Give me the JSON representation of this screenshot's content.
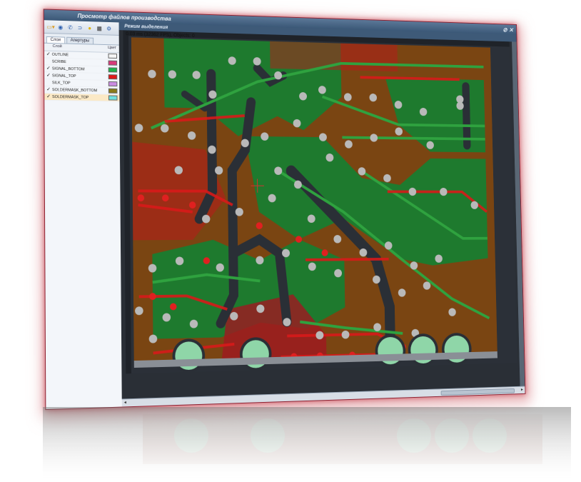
{
  "window": {
    "title": "Просмотр файлов производства",
    "controls": "⊘ ✕"
  },
  "toolbar": {
    "icons": [
      "folder-open-icon",
      "layers-icon",
      "phone-icon",
      "link-icon",
      "sun-icon",
      "grid-icon",
      "settings-icon"
    ]
  },
  "tabs": [
    {
      "label": "Слои",
      "active": true
    },
    {
      "label": "Апертуры",
      "active": false
    }
  ],
  "layers_panel": {
    "col_layer": "Слой",
    "col_color": "Цвет",
    "layers": [
      {
        "name": "OUTLINE",
        "checked": true,
        "color": "#f4f4f4"
      },
      {
        "name": "SCRIBE",
        "checked": false,
        "color": "#d93a7a"
      },
      {
        "name": "SIGNAL_BOTTOM",
        "checked": true,
        "color": "#1db34a"
      },
      {
        "name": "SIGNAL_TOP",
        "checked": true,
        "color": "#e01818"
      },
      {
        "name": "SILK_TOP",
        "checked": false,
        "color": "#c98be0"
      },
      {
        "name": "SOLDERMASK_BOTTOM",
        "checked": true,
        "color": "#8a7a1a"
      },
      {
        "name": "SOLDERMASK_TOP",
        "checked": true,
        "color": "#6fe0e0",
        "selected": true
      }
    ]
  },
  "viewer": {
    "mode_title": "Режим выделения",
    "fps_text": "0.03 ms (32362 FPS), Objects: 0"
  },
  "colors": {
    "board_bg": "#7a4512",
    "copper_bottom": "#1e7a2e",
    "copper_top": "#b81a1a",
    "via_fill": "#b9b9b9",
    "pad_fill": "#8fd6a8",
    "window_border": "#8d2030"
  }
}
